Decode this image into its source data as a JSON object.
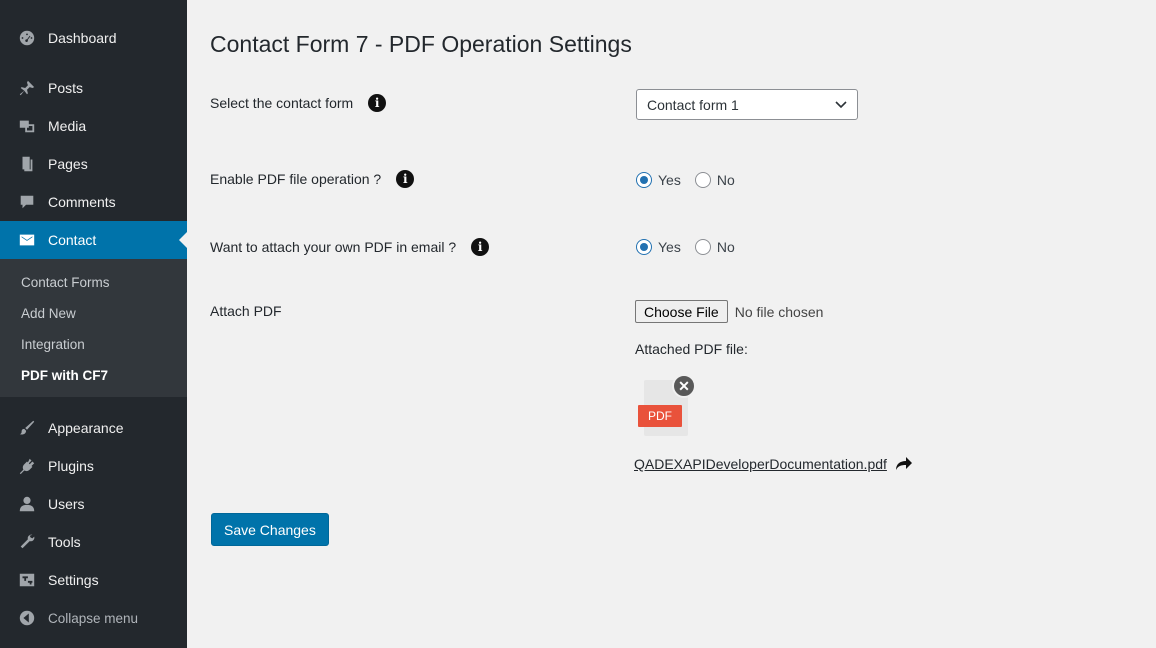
{
  "sidebar": {
    "dashboard": "Dashboard",
    "posts": "Posts",
    "media": "Media",
    "pages": "Pages",
    "comments": "Comments",
    "contact": "Contact",
    "submenu": [
      "Contact Forms",
      "Add New",
      "Integration",
      "PDF with CF7"
    ],
    "appearance": "Appearance",
    "plugins": "Plugins",
    "users": "Users",
    "tools": "Tools",
    "settings": "Settings",
    "collapse": "Collapse menu"
  },
  "main": {
    "title": "Contact Form 7 - PDF Operation Settings",
    "select_form_label": "Select the contact form",
    "select_form_value": "Contact form 1",
    "enable_pdf_label": "Enable PDF file operation ?",
    "attach_own_label": "Want to attach your own PDF in email ?",
    "radio_yes": "Yes",
    "radio_no": "No",
    "attach_pdf_label": "Attach PDF",
    "choose_file_button": "Choose File",
    "file_status": "No file chosen",
    "attached_file_label": "Attached PDF file:",
    "pdf_tag": "PDF",
    "attached_file_name": "QADEXAPIDeveloperDocumentation.pdf",
    "save_button": "Save Changes"
  },
  "colors": {
    "sidebar_bg": "#23282d",
    "accent": "#0073aa",
    "pdf_red": "#e9523b"
  }
}
